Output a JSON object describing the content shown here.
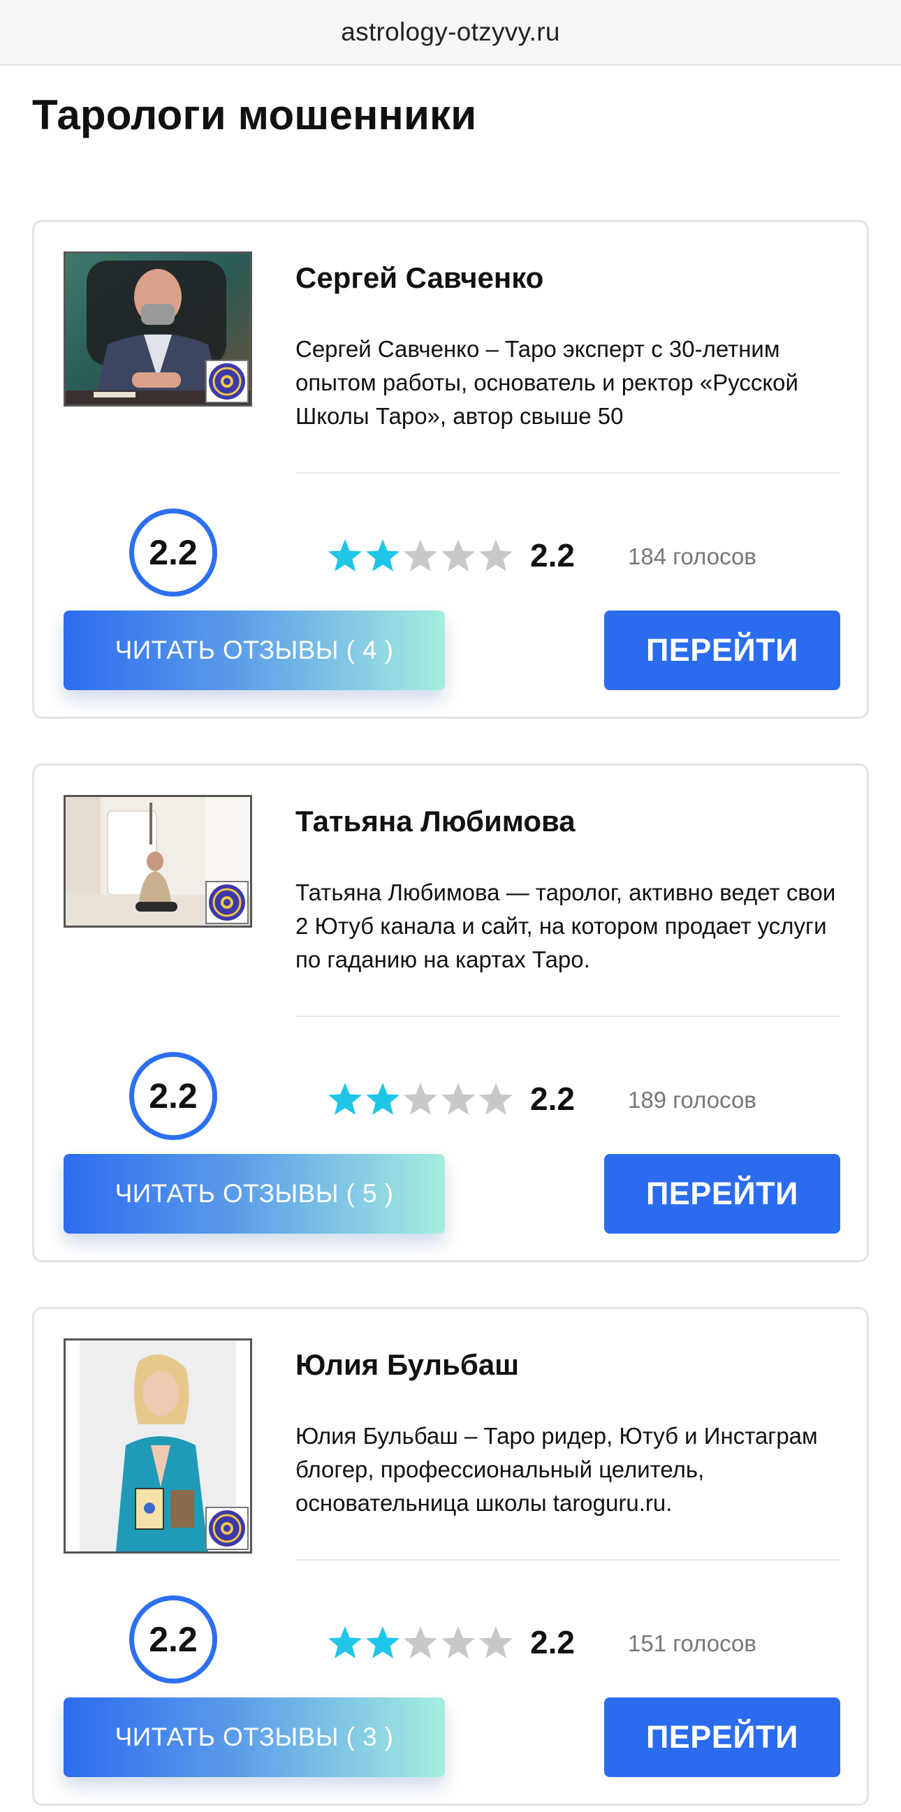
{
  "browser": {
    "url": "astrology-otzyvy.ru"
  },
  "page": {
    "title": "Тарологи мошенники"
  },
  "colors": {
    "accent": "#2b6cee",
    "star_filled": "#1fc6e8",
    "star_empty": "#c8c8c8"
  },
  "cards": [
    {
      "name": "Сергей Савченко",
      "description": "Сергей Савченко – Таро эксперт с 30-летним опытом работы, основатель и ректор «Русской Школы Таро», автор свыше 50",
      "score": "2.2",
      "rating": "2.2",
      "stars_filled": 2,
      "votes": "184 голосов",
      "reviews_label": "ЧИТАТЬ ОТЗЫВЫ ( 4 )",
      "go_label": "ПЕРЕЙТИ"
    },
    {
      "name": "Татьяна Любимова",
      "description": "Татьяна Любимова — таролог, активно ведет свои 2 Ютуб канала и сайт, на котором продает услуги по гаданию на картах Таро.",
      "score": "2.2",
      "rating": "2.2",
      "stars_filled": 2,
      "votes": "189 голосов",
      "reviews_label": "ЧИТАТЬ ОТЗЫВЫ ( 5 )",
      "go_label": "ПЕРЕЙТИ"
    },
    {
      "name": "Юлия Бульбаш",
      "description": "Юлия Бульбаш – Таро ридер, Ютуб и Инстаграм блогер, профессиональный целитель, основательница школы taroguru.ru.",
      "score": "2.2",
      "rating": "2.2",
      "stars_filled": 2,
      "votes": "151 голосов",
      "reviews_label": "ЧИТАТЬ ОТЗЫВЫ ( 3 )",
      "go_label": "ПЕРЕЙТИ"
    }
  ]
}
